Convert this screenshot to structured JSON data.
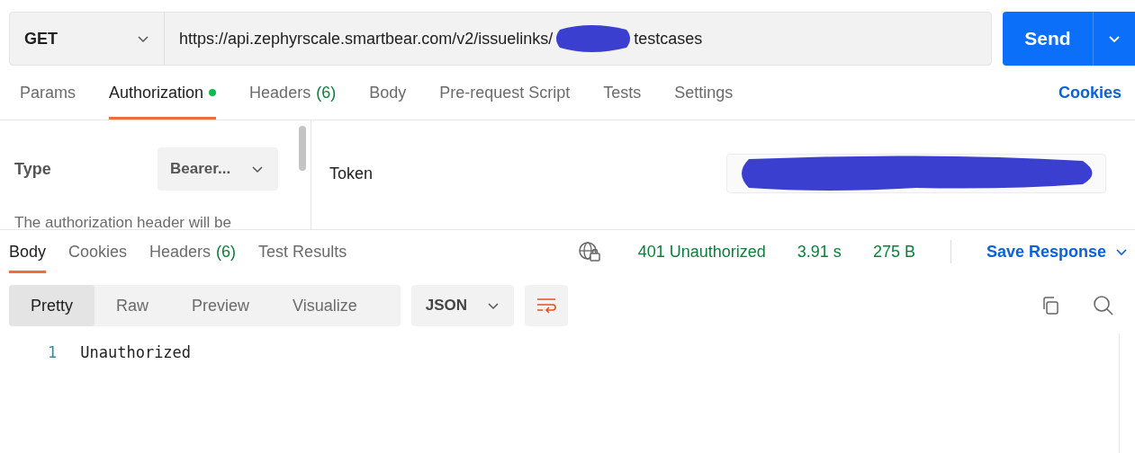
{
  "request": {
    "method": "GET",
    "url_before": "https://api.zephyrscale.smartbear.com/v2/issuelinks/",
    "url_after": "testcases",
    "send": "Send"
  },
  "request_tabs": [
    {
      "label": "Params",
      "selected": false
    },
    {
      "label": "Authorization",
      "selected": true,
      "dot": true
    },
    {
      "label": "Headers",
      "count": "(6)",
      "selected": false
    },
    {
      "label": "Body",
      "selected": false
    },
    {
      "label": "Pre-request Script",
      "selected": false
    },
    {
      "label": "Tests",
      "selected": false
    },
    {
      "label": "Settings",
      "selected": false
    }
  ],
  "cookies_link": "Cookies",
  "auth": {
    "type_label": "Type",
    "type_value": "Bearer...",
    "note": "The authorization header will be",
    "token_label": "Token"
  },
  "response_tabs": [
    {
      "label": "Body",
      "selected": true
    },
    {
      "label": "Cookies",
      "selected": false
    },
    {
      "label": "Headers",
      "count": "(6)",
      "selected": false
    },
    {
      "label": "Test Results",
      "selected": false
    }
  ],
  "response_status": {
    "status": "401 Unauthorized",
    "time": "3.91 s",
    "size": "275 B",
    "save": "Save Response"
  },
  "view_modes": [
    {
      "label": "Pretty",
      "selected": true
    },
    {
      "label": "Raw",
      "selected": false
    },
    {
      "label": "Preview",
      "selected": false
    },
    {
      "label": "Visualize",
      "selected": false
    }
  ],
  "format": "JSON",
  "body_lines": [
    {
      "number": "1",
      "text": "Unauthorized"
    }
  ]
}
